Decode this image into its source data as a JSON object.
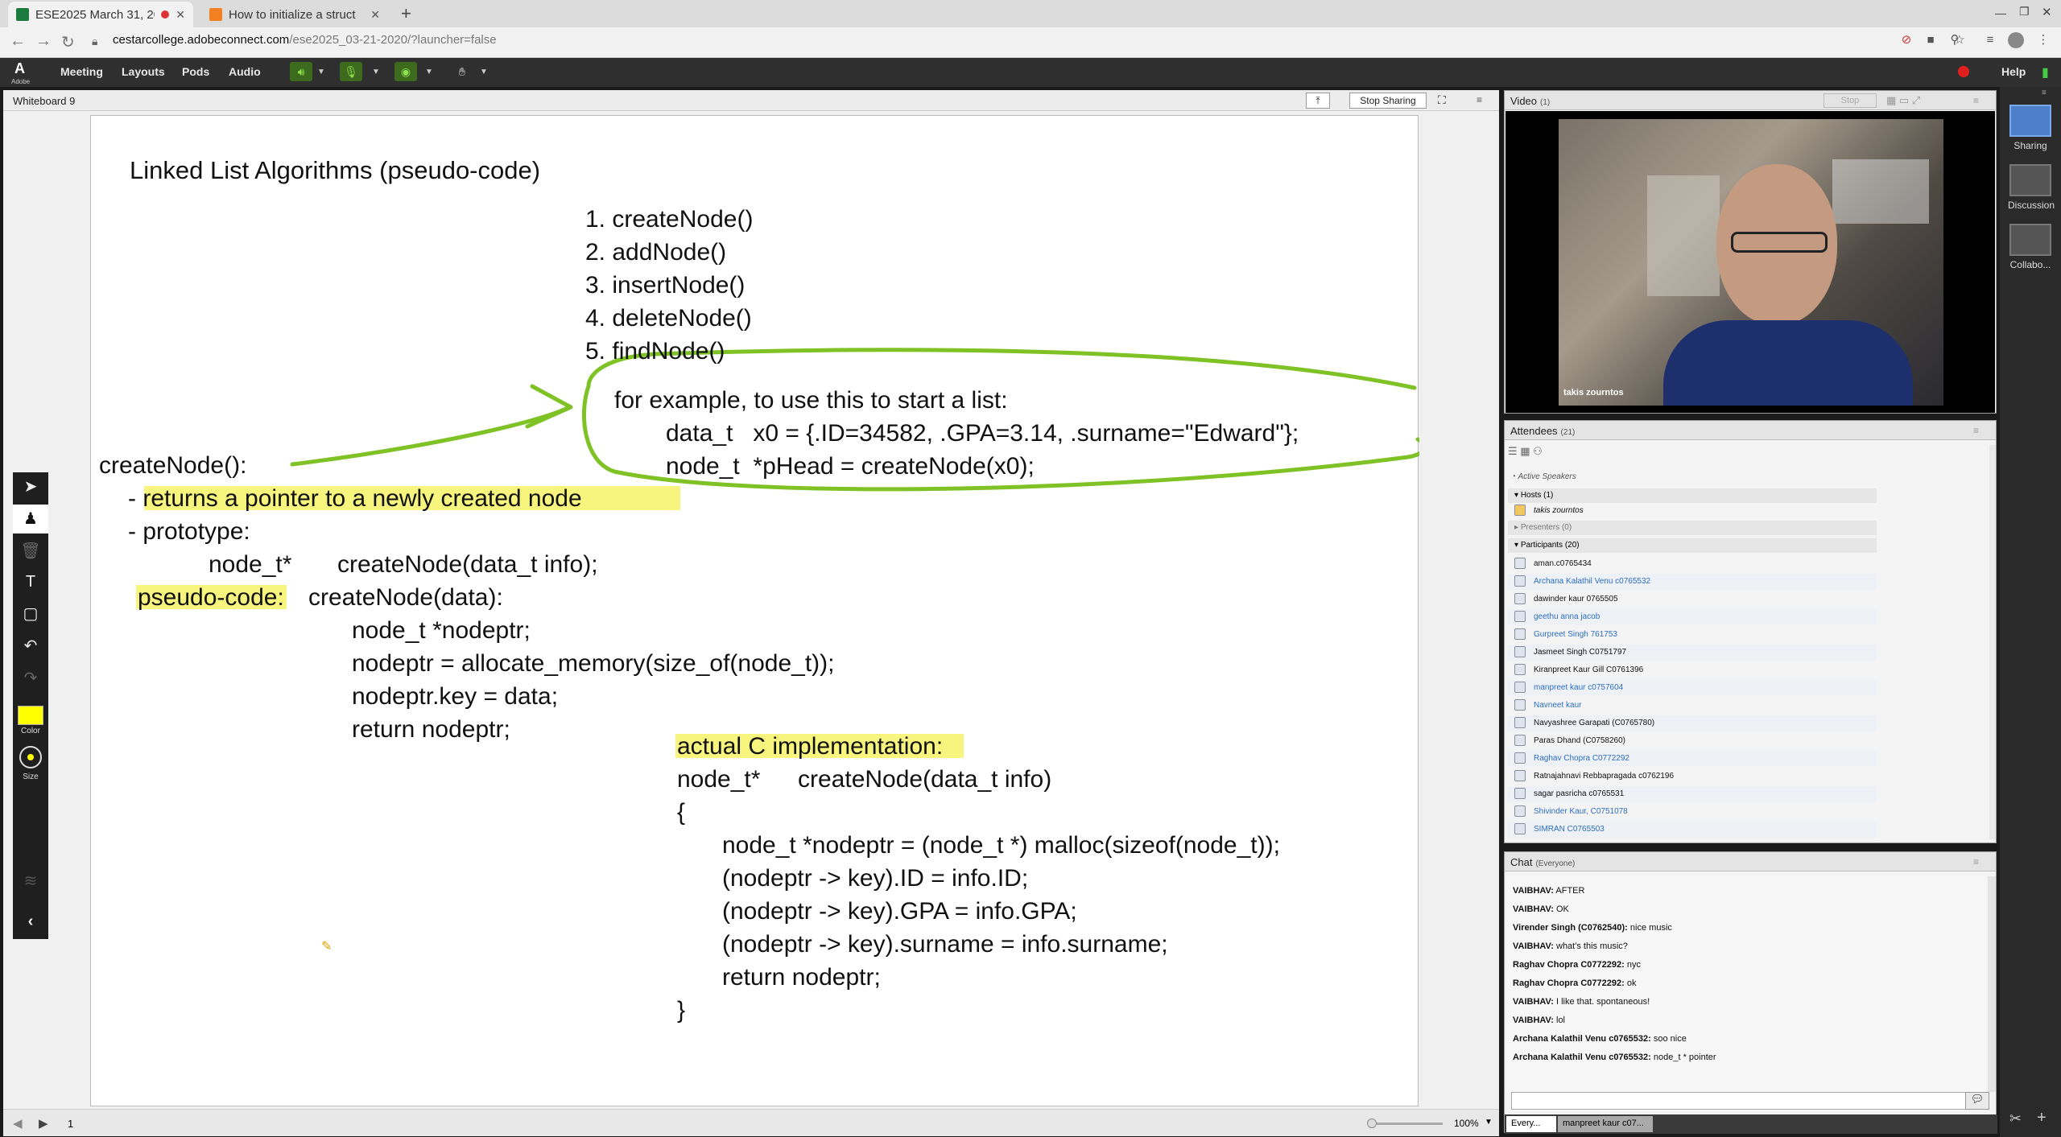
{
  "browser": {
    "tabs": [
      {
        "title": "ESE2025 March 31, 20",
        "active": true
      },
      {
        "title": "How to initialize a struct",
        "active": false
      }
    ],
    "url_host": "cestarcollege.adobeconnect.com",
    "url_path": "/ese2025_03-21-2020/?launcher=false"
  },
  "connect_menu": {
    "logo": "Adobe",
    "items": [
      "Meeting",
      "Layouts",
      "Pods",
      "Audio"
    ],
    "help": "Help"
  },
  "whiteboard": {
    "pod_title": "Whiteboard 9",
    "stop_sharing": "Stop Sharing",
    "page_number": "1",
    "zoom": "100%",
    "tool_labels": {
      "color": "Color",
      "size": "Size"
    },
    "content": {
      "title": "Linked List Algorithms (pseudo-code)",
      "functions": [
        "1. createNode()",
        "2. addNode()",
        "3. insertNode()",
        "4. deleteNode()",
        "5. findNode()"
      ],
      "example_lines": [
        "for example, to use this to start a list:",
        "data_t   x0 = {.ID=34582, .GPA=3.14, .surname=\"Edward\"};",
        "node_t  *pHead = createNode(x0);"
      ],
      "create_header": "createNode():",
      "returns_line": "- returns a pointer to a newly created node",
      "prototype_label": "- prototype:",
      "prototype_type": "node_t*",
      "prototype_sig": "createNode(data_t info);",
      "pseudo_label": "pseudo-code:",
      "pseudo_lines": [
        "createNode(data):",
        "node_t *nodeptr;",
        "nodeptr = allocate_memory(size_of(node_t));",
        "nodeptr.key = data;",
        "return nodeptr;"
      ],
      "c_label": "actual C implementation:",
      "c_sig_type": "node_t*",
      "c_sig_name": "createNode(data_t info)",
      "c_open": "{",
      "c_body": [
        "node_t *nodeptr = (node_t *) malloc(sizeof(node_t));",
        "(nodeptr -> key).ID = info.ID;",
        "(nodeptr -> key).GPA = info.GPA;",
        "(nodeptr -> key).surname = info.surname;",
        "return nodeptr;"
      ],
      "c_close": "}"
    }
  },
  "video": {
    "title": "Video",
    "count": "(1)",
    "stop": "Stop",
    "speaker_name": "takis zourntos"
  },
  "attendees": {
    "title": "Attendees",
    "count": "(21)",
    "active_speakers": "Active Speakers",
    "hosts_label": "Hosts (1)",
    "host": "takis zourntos",
    "presenters_label": "Presenters (0)",
    "participants_label": "Participants (20)",
    "participants": [
      {
        "name": "aman.c0765434",
        "blue": false
      },
      {
        "name": "Archana Kalathil Venu c0765532",
        "blue": true
      },
      {
        "name": "dawinder kaur 0765505",
        "blue": false
      },
      {
        "name": "geethu anna jacob",
        "blue": true
      },
      {
        "name": "Gurpreet Singh 761753",
        "blue": true
      },
      {
        "name": "Jasmeet Singh C0751797",
        "blue": false
      },
      {
        "name": "Kiranpreet Kaur Gill C0761396",
        "blue": false
      },
      {
        "name": "manpreet kaur c0757604",
        "blue": true
      },
      {
        "name": "Navneet kaur",
        "blue": true
      },
      {
        "name": "Navyashree Garapati (C0765780)",
        "blue": false
      },
      {
        "name": "Paras Dhand (C0758260)",
        "blue": false
      },
      {
        "name": "Raghav Chopra C0772292",
        "blue": true
      },
      {
        "name": "Ratnajahnavi Rebbapragada c0762196",
        "blue": false
      },
      {
        "name": "sagar pasricha c0765531",
        "blue": false
      },
      {
        "name": "Shivinder Kaur, C0751078",
        "blue": true
      },
      {
        "name": "SIMRAN C0765503",
        "blue": true
      }
    ]
  },
  "chat": {
    "title": "Chat",
    "scope": "(Everyone)",
    "messages": [
      {
        "who": "VAIBHAV:",
        "text": "AFTER"
      },
      {
        "who": "VAIBHAV:",
        "text": "OK"
      },
      {
        "who": "Virender Singh (C0762540):",
        "text": "nice music"
      },
      {
        "who": "VAIBHAV:",
        "text": "what's this music?"
      },
      {
        "who": "Raghav Chopra C0772292:",
        "text": "nyc"
      },
      {
        "who": "Raghav Chopra C0772292:",
        "text": "ok"
      },
      {
        "who": "VAIBHAV:",
        "text": "I like that. spontaneous!"
      },
      {
        "who": "VAIBHAV:",
        "text": "lol"
      },
      {
        "who": "Archana Kalathil Venu c0765532:",
        "text": "soo nice"
      },
      {
        "who": "Archana Kalathil Venu c0765532:",
        "text": "node_t * pointer"
      }
    ],
    "tabs": [
      "Every...",
      "manpreet kaur c07..."
    ]
  },
  "layouts": [
    "Sharing",
    "Discussion",
    "Collabo..."
  ],
  "colors": {
    "highlight": "#f4f251",
    "annotation_green": "#7ec225",
    "participant_blue": "#2a6dc2"
  }
}
